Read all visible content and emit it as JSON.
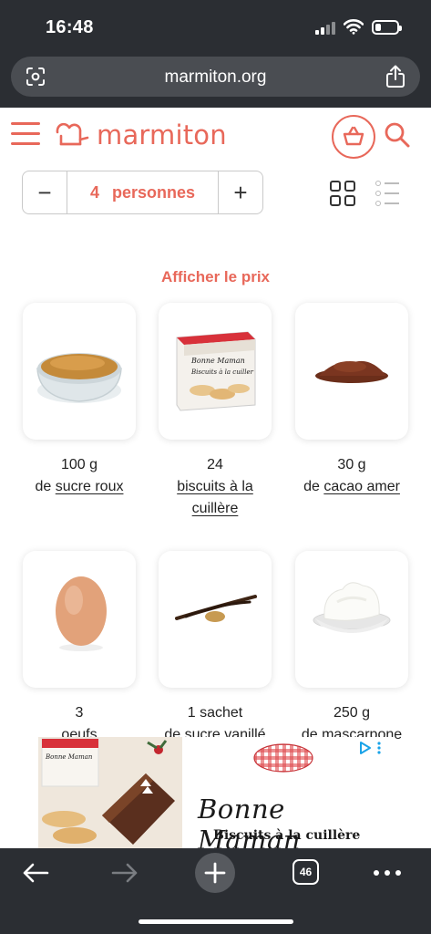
{
  "status_bar": {
    "time": "16:48"
  },
  "browser": {
    "url": "marmiton.org",
    "open_tabs": "46"
  },
  "header": {
    "logo_text": "marmiton"
  },
  "servings": {
    "minus": "−",
    "count": "4",
    "unit": "personnes",
    "plus": "+"
  },
  "price_link": "Afficher le prix",
  "ingredients": [
    {
      "qty": "100 g",
      "prefix": "de ",
      "name": "sucre roux",
      "linked": true
    },
    {
      "qty": "24",
      "prefix": "",
      "name": "biscuits à la cuillère",
      "linked": true
    },
    {
      "qty": "30 g",
      "prefix": "de ",
      "name": "cacao amer",
      "linked": true
    },
    {
      "qty": "3",
      "prefix": "",
      "name": "oeufs",
      "linked": false
    },
    {
      "qty": "1 sachet",
      "prefix": "",
      "name": "de sucre vanillé",
      "linked": false
    },
    {
      "qty": "250 g",
      "prefix": "",
      "name": "de mascarpone",
      "linked": false
    }
  ],
  "ad": {
    "brand": "Bonne Maman",
    "tagline": "Biscuits à la cuillère",
    "choices_icon": "ad-choices-icon"
  },
  "colors": {
    "accent": "#e8685a",
    "chrome": "#2b2e33",
    "url_bar": "#4a4d52"
  }
}
